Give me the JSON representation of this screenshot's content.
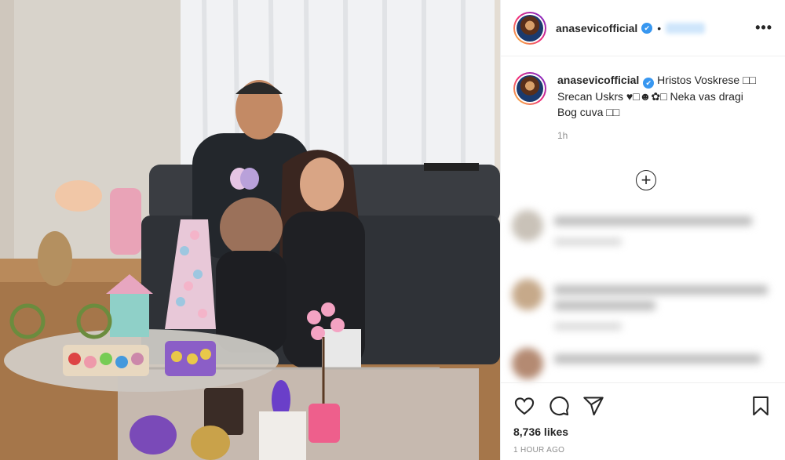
{
  "post": {
    "username": "anasevicofficial",
    "verified_mark": "✔",
    "dot": "•",
    "more_glyph": "•••",
    "caption_text": "Hristos Voskrese □□ Srecan Uskrs ♥□☻✿□ Neka vas dragi Bog cuva □□",
    "caption_time": "1h",
    "add_glyph": "+",
    "likes": "8,736 likes",
    "posted_ago": "1 HOUR AGO"
  },
  "icons": {
    "like": "heart-icon",
    "comment": "comment-icon",
    "share": "send-icon",
    "save": "bookmark-icon",
    "more": "more-options-icon",
    "add": "plus-circle-icon"
  },
  "colors": {
    "verified": "#3897f0",
    "text": "#262626",
    "muted": "#8e8e8e",
    "border": "#efefef"
  }
}
